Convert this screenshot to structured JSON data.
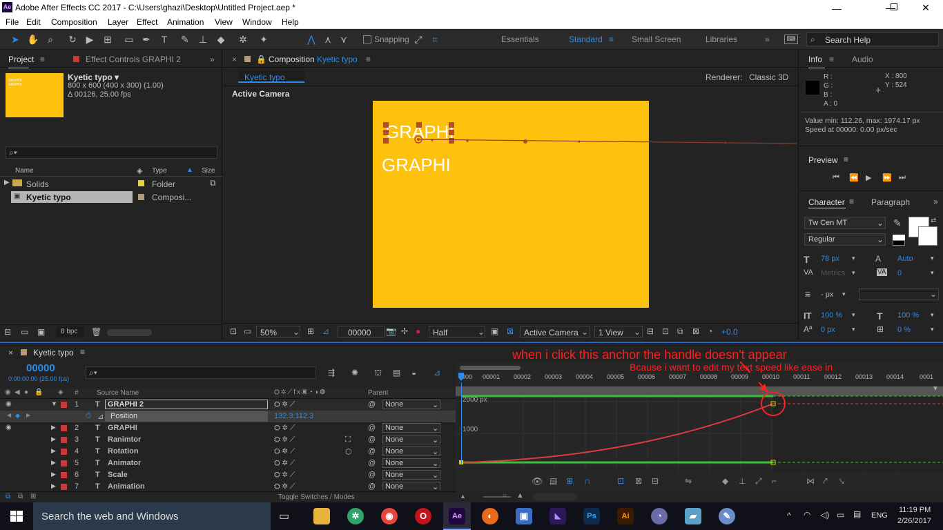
{
  "title": "Adobe After Effects CC 2017 - C:\\Users\\ghazi\\Desktop\\Untitled Project.aep *",
  "app_icon": "Ae",
  "menu": [
    "File",
    "Edit",
    "Composition",
    "Layer",
    "Effect",
    "Animation",
    "View",
    "Window",
    "Help"
  ],
  "toolbar": {
    "snapping": "Snapping",
    "workspaces": [
      "Essentials",
      "Standard",
      "Small Screen",
      "Libraries"
    ],
    "search_placeholder": "Search Help"
  },
  "project": {
    "tab_project": "Project",
    "tab_effects": "Effect Controls GRAPHI 2",
    "thumb_text": "GRAPHI\nGRAPHI",
    "comp_name": "Kyetic typo ▾",
    "comp_size": "800 x 600  (400 x 300) (1.00)",
    "comp_duration": "Δ 00126, 25.00 fps",
    "col_name": "Name",
    "col_type": "Type",
    "col_size": "Size",
    "items": [
      {
        "name": "Solids",
        "type": "Folder",
        "color": "#e0d04a"
      },
      {
        "name": "Kyetic typo",
        "type": "Composi...",
        "color": "#b89a7a"
      }
    ],
    "bpc": "8 bpc"
  },
  "composition": {
    "tab_prefix": "Composition",
    "tab_name": "Kyetic typo",
    "subtab": "Kyetic typo",
    "renderer_label": "Renderer:",
    "renderer_value": "Classic 3D",
    "active_camera": "Active Camera",
    "canvas_text1": "GRAPHI",
    "canvas_text2": "GRAPHI",
    "canvas_color": "#fec20e",
    "zoom": "50%",
    "timecode": "00000",
    "resolution": "Half",
    "view_camera": "Active Camera",
    "view_count": "1 View",
    "exposure": "+0.0"
  },
  "info": {
    "tab_info": "Info",
    "tab_audio": "Audio",
    "r": "R :",
    "g": "G :",
    "b": "B :",
    "a": "A : 0",
    "x": "X : 800",
    "y": "Y : 524",
    "value_range": "Value min: 112.26, max: 1974.17 px",
    "speed": "Speed at 00000: 0.00 px/sec"
  },
  "preview": {
    "title": "Preview"
  },
  "character": {
    "tab_char": "Character",
    "tab_para": "Paragraph",
    "font": "Tw Cen MT",
    "style": "Regular",
    "size": "78 px",
    "leading": "Auto",
    "kerning": "Metrics",
    "tracking": "0",
    "stroke_width": "- px",
    "vscale": "100 %",
    "hscale": "100 %",
    "baseline": "0 px",
    "tsume": "0 %"
  },
  "timeline": {
    "comp_tab": "Kyetic typo",
    "timecode": "00000",
    "timecode_sub": "0:00:00:00 (25.00 fps)",
    "col_num": "#",
    "col_source": "Source Name",
    "col_parent": "Parent",
    "ruler": [
      "0000",
      "00001",
      "00002",
      "00003",
      "00004",
      "00005",
      "00006",
      "00007",
      "00008",
      "00009",
      "00010",
      "00011",
      "00012",
      "00013",
      "00014",
      "0001"
    ],
    "graph_label_top": "2000 px",
    "graph_label_mid": "1000",
    "toggle_label": "Toggle Switches / Modes",
    "layers": [
      {
        "num": "1",
        "name": "GRAPHI 2",
        "parent": "None"
      },
      {
        "num": "",
        "name": "Position",
        "parent": "",
        "value": "132.3,112.3"
      },
      {
        "num": "2",
        "name": "GRAPHI",
        "parent": "None"
      },
      {
        "num": "3",
        "name": "Ranimtor",
        "parent": "None"
      },
      {
        "num": "4",
        "name": "Rotation",
        "parent": "None"
      },
      {
        "num": "5",
        "name": "Animator",
        "parent": "None"
      },
      {
        "num": "6",
        "name": "Scale",
        "parent": "None"
      },
      {
        "num": "7",
        "name": "Animation",
        "parent": "None"
      }
    ]
  },
  "annotation": {
    "line1": "when i click this anchor the handle doesn't appear",
    "line2": "Bcause i want to edit my text speed like ease in",
    "color": "#ff2020"
  },
  "taskbar": {
    "search": "Search the web and Windows",
    "lang": "ENG",
    "time": "11:19 PM",
    "date": "2/26/2017"
  }
}
